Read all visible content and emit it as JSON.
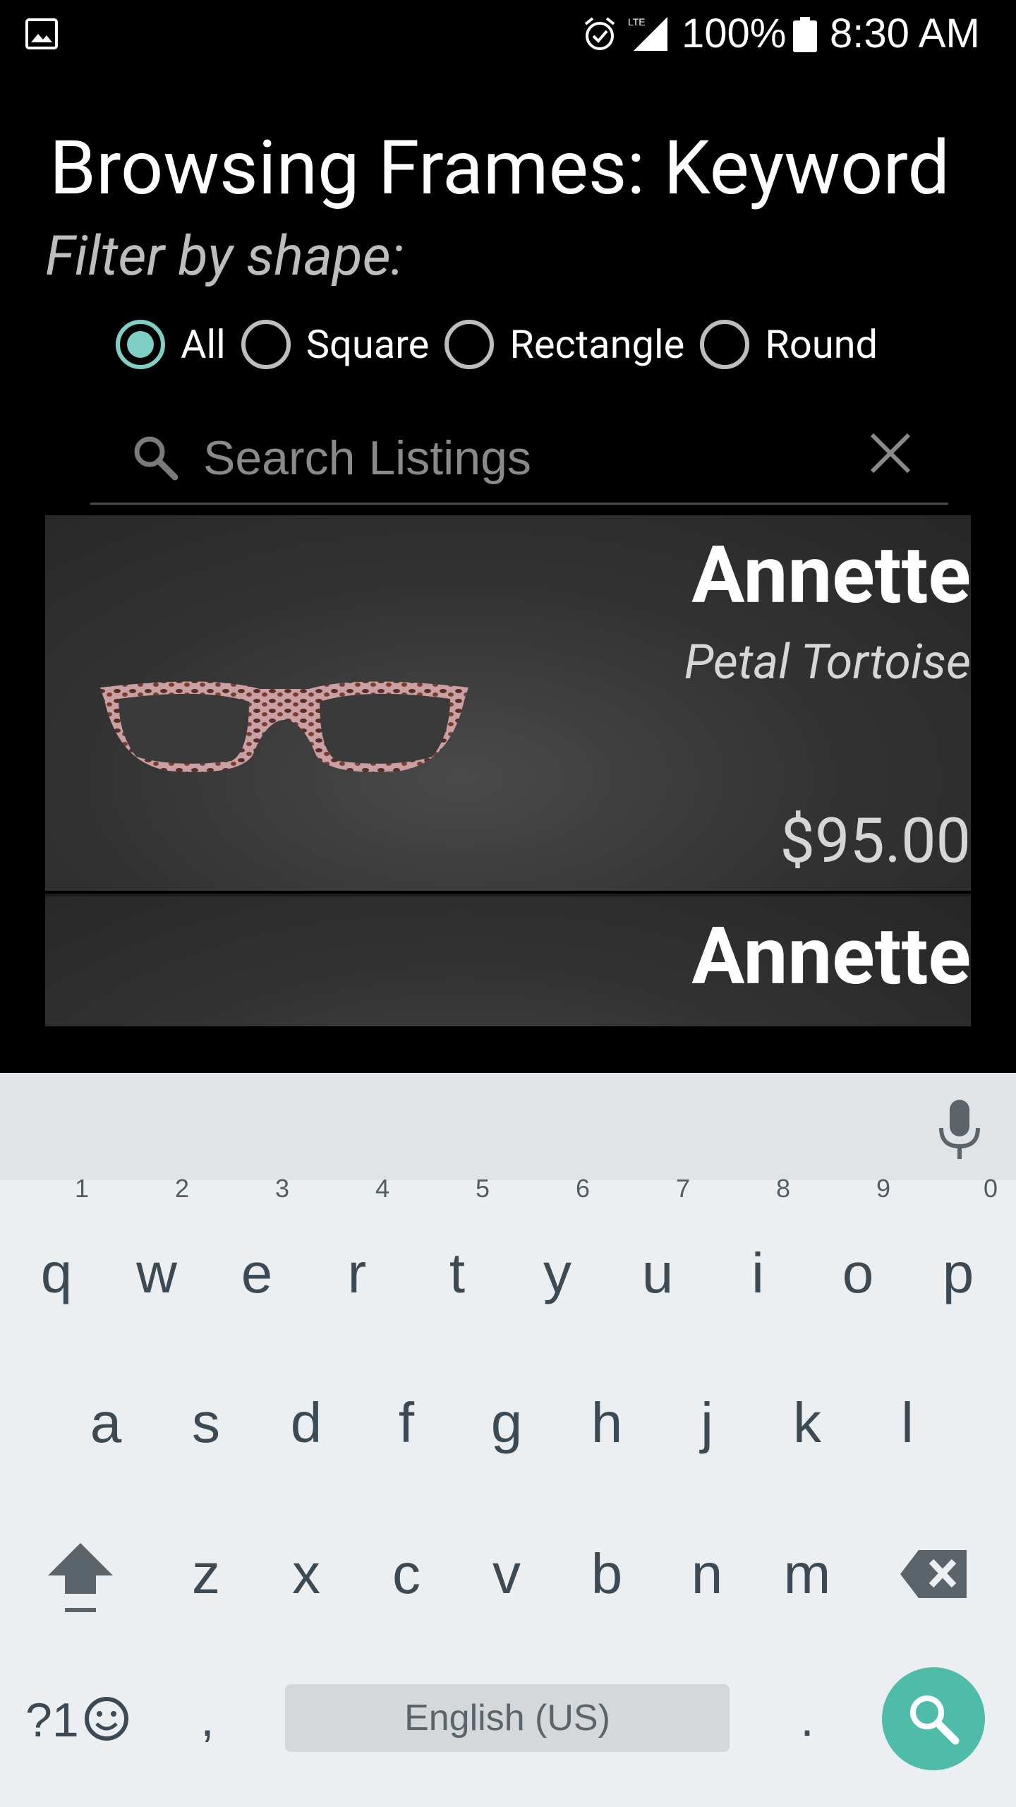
{
  "status_bar": {
    "battery_percent": "100%",
    "time": "8:30 AM",
    "network": "LTE",
    "icons": [
      "gallery-icon",
      "alarm-icon",
      "signal-icon",
      "battery-icon"
    ]
  },
  "header": {
    "title": "Browsing Frames: Keyword",
    "filter_label": "Filter by shape:"
  },
  "filters": [
    {
      "label": "All",
      "selected": true
    },
    {
      "label": "Square",
      "selected": false
    },
    {
      "label": "Rectangle",
      "selected": false
    },
    {
      "label": "Round",
      "selected": false
    }
  ],
  "search": {
    "placeholder": "Search Listings",
    "value": ""
  },
  "listings": [
    {
      "name": "Annette",
      "color": "Petal Tortoise",
      "price": "$95.00"
    },
    {
      "name": "Annette",
      "color": "",
      "price": ""
    }
  ],
  "keyboard": {
    "row1": [
      "q",
      "w",
      "e",
      "r",
      "t",
      "y",
      "u",
      "i",
      "o",
      "p"
    ],
    "row1_hints": [
      "1",
      "2",
      "3",
      "4",
      "5",
      "6",
      "7",
      "8",
      "9",
      "0"
    ],
    "row2": [
      "a",
      "s",
      "d",
      "f",
      "g",
      "h",
      "j",
      "k",
      "l"
    ],
    "row3": [
      "z",
      "x",
      "c",
      "v",
      "b",
      "n",
      "m"
    ],
    "symbols_label": "?1",
    "comma": ",",
    "period": ".",
    "space_label": "English (US)",
    "accent_color": "#4fbcaa"
  }
}
